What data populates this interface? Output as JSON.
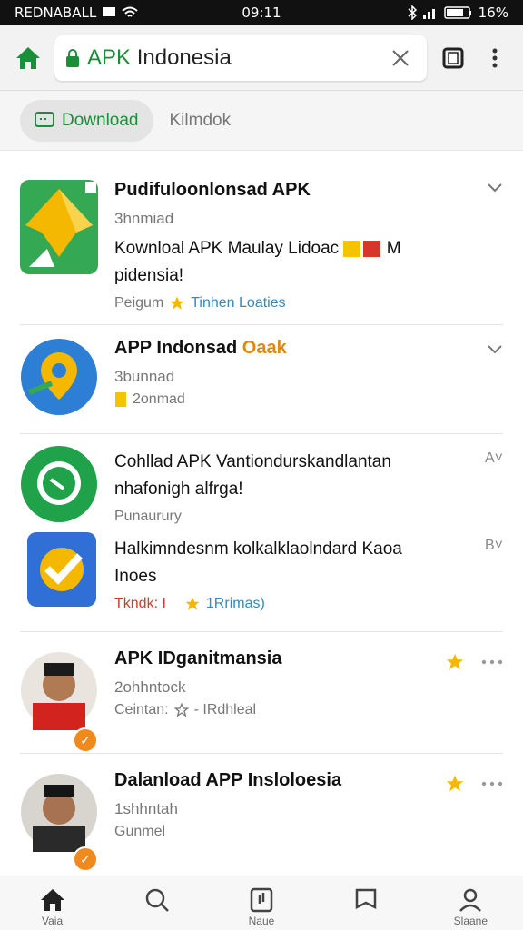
{
  "status": {
    "carrier": "REDNABALL",
    "time": "09:11",
    "battery": "16%"
  },
  "urlbar": {
    "url_prefix": "APK",
    "url_rest": " Indonesia"
  },
  "chips": {
    "download": "Download",
    "second": "Kilmdok"
  },
  "items": [
    {
      "title": "Pudifuloonlonsad APK",
      "title_accent": "",
      "sub": "3hnmiad",
      "desc": "Kownloal APK Maulay Lidoac",
      "desc_tail": "M",
      "desc2": "pidensia!",
      "meta": "Peigum",
      "meta_link": "Tinhen Loaties",
      "side": "chevron"
    },
    {
      "title": "APP Indonsad ",
      "title_accent": "Oaak",
      "sub": "3bunnad",
      "meta_extra": "2onmad",
      "side": "chevron"
    },
    {
      "title": "",
      "desc": "Cohllad APK Vantiondurskandlantan",
      "desc2": "nhafonigh alfrga!",
      "meta": "Punaurury",
      "side_text": "A"
    },
    {
      "title": "",
      "desc": "Halkimndesnm kolkalklaolndard Kaoa",
      "desc2": "Inoes",
      "meta_red": "Tkndk: I",
      "meta_link": "1Rrimas)",
      "side_text": "B"
    },
    {
      "title": "APK IDganitmansia",
      "sub": "2ohhntock",
      "meta": "Ceintan: ",
      "meta_tail": " - IRdhleal",
      "side": "star"
    },
    {
      "title": "Dalanload APP Insloloesia",
      "sub": "1shhntah",
      "meta": "Gunmel",
      "side": "star"
    }
  ],
  "nav": {
    "home": "Vaia",
    "search": "",
    "middle": "Naue",
    "saved": "",
    "profile": "Slaane"
  },
  "colors": {
    "accent": "#1a8f3a",
    "star": "#f5b800"
  }
}
